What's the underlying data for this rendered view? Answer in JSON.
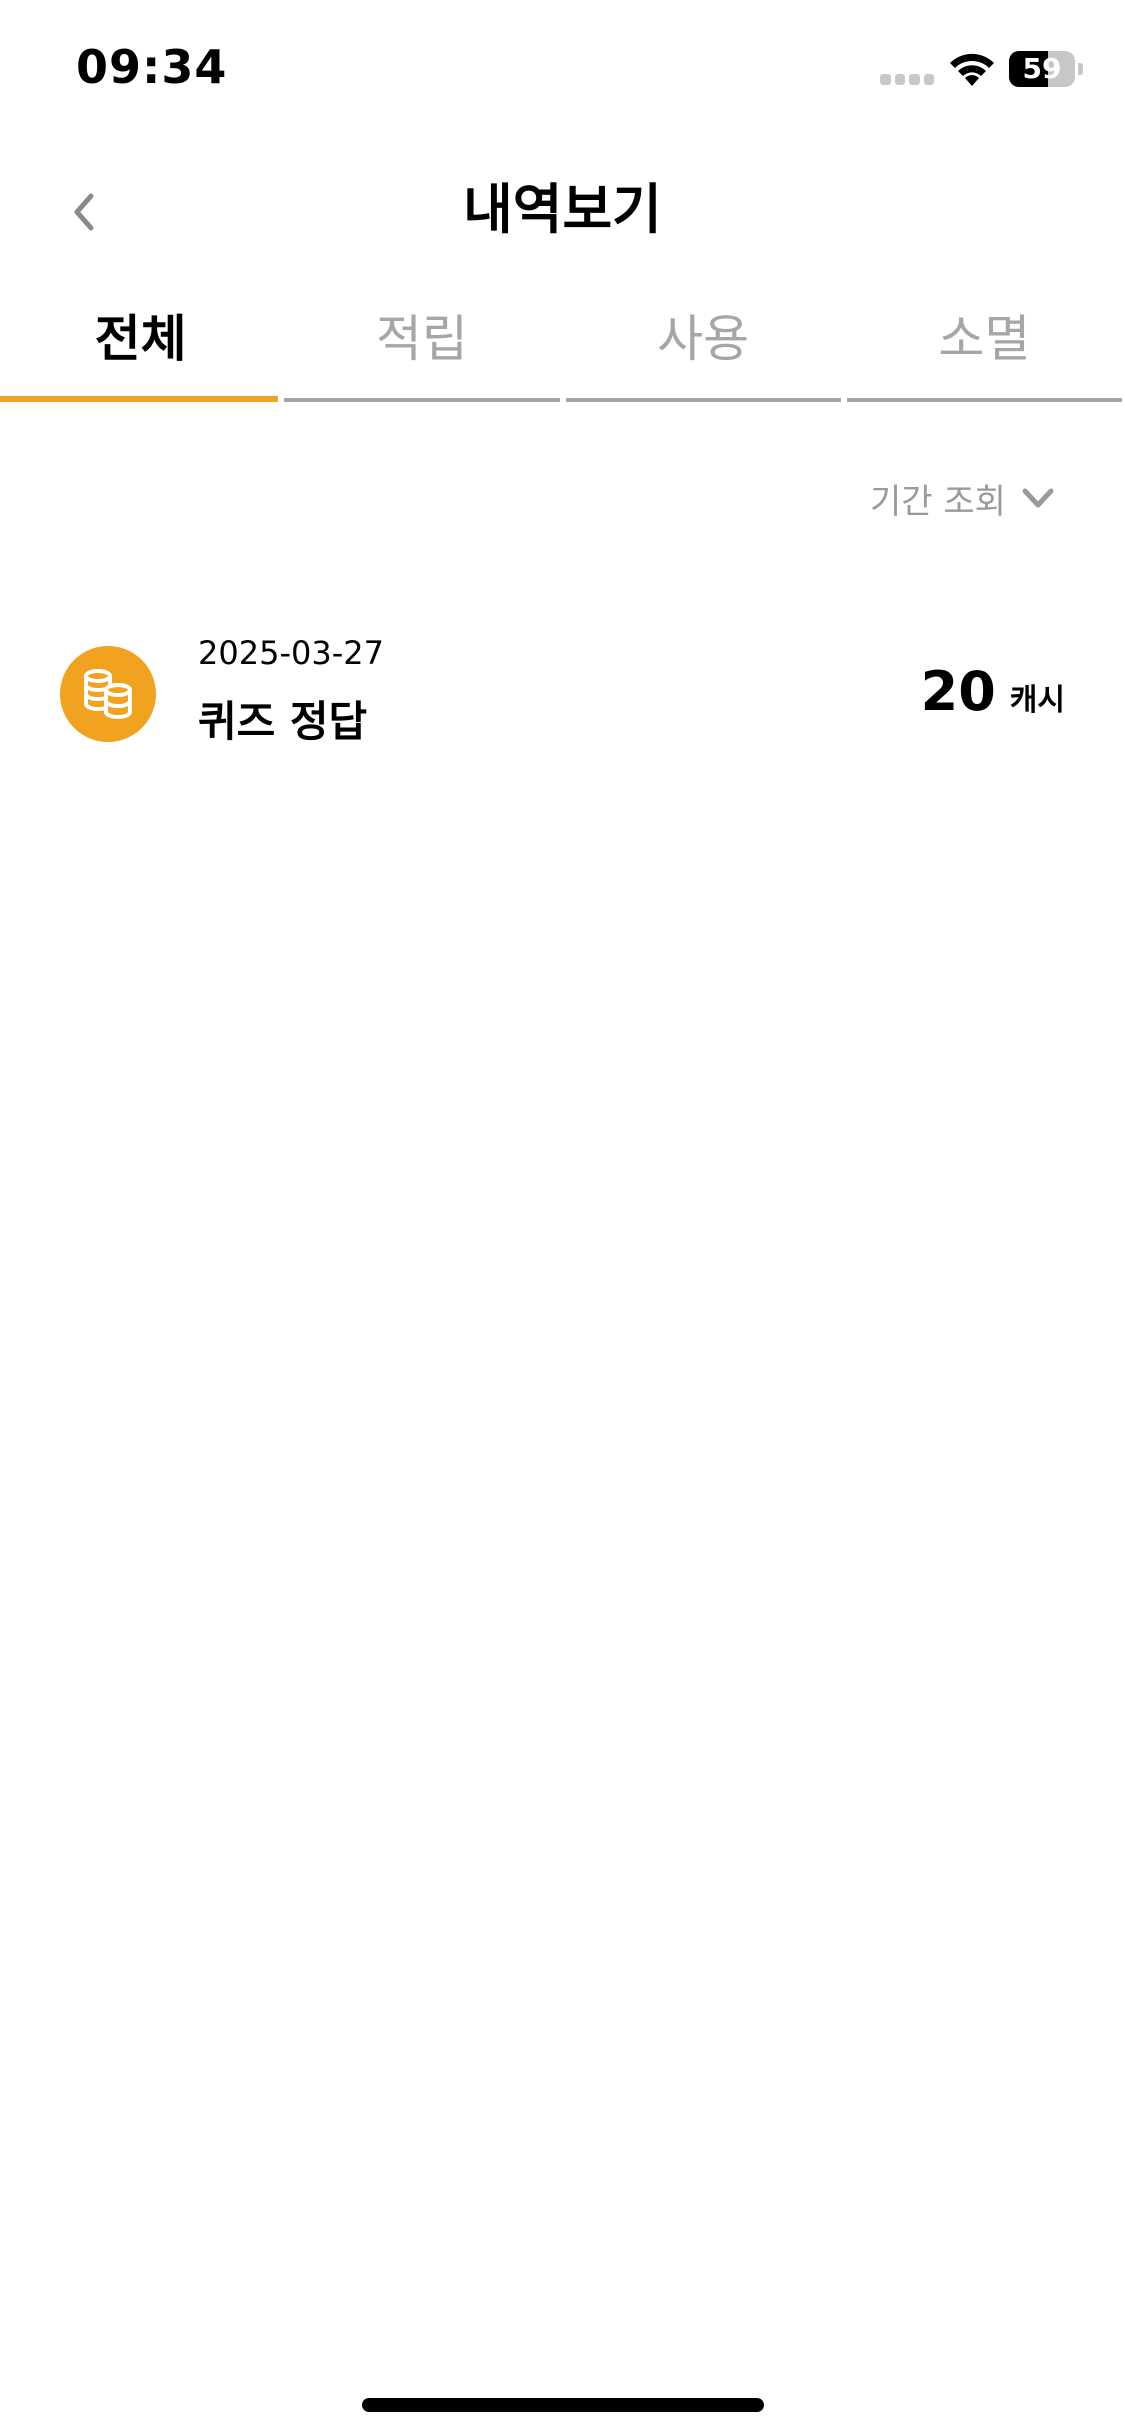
{
  "status_bar": {
    "time": "09:34",
    "battery_level": "59",
    "battery_fraction": 0.59
  },
  "header": {
    "title": "내역보기",
    "back_icon": "chevron-left-icon"
  },
  "tabs": [
    {
      "label": "전체",
      "active": true
    },
    {
      "label": "적립",
      "active": false
    },
    {
      "label": "사용",
      "active": false
    },
    {
      "label": "소멸",
      "active": false
    }
  ],
  "filter": {
    "label": "기간 조회",
    "icon": "chevron-down-icon"
  },
  "history": [
    {
      "date": "2025-03-27",
      "title": "퀴즈 정답",
      "amount": "20",
      "unit": "캐시",
      "icon": "coins-icon"
    }
  ],
  "colors": {
    "accent": "#f1a21f",
    "inactive_text": "#a6a6a6",
    "text": "#000000"
  }
}
